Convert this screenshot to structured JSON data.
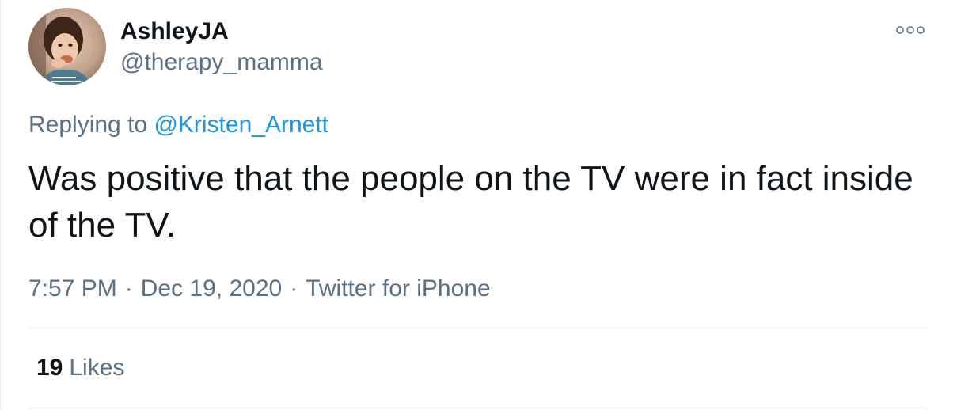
{
  "author": {
    "display_name": "AshleyJA",
    "handle": "@therapy_mamma"
  },
  "reply": {
    "prefix": "Replying to",
    "mention": "@Kristen_Arnett"
  },
  "tweet": {
    "text": "Was positive that the people on the TV were in fact inside of the TV."
  },
  "meta": {
    "time": "7:57 PM",
    "separator": "·",
    "date": "Dec 19, 2020",
    "source": "Twitter for iPhone"
  },
  "stats": {
    "likes_count": "19",
    "likes_label": "Likes"
  },
  "icons": {
    "more": "more-options-icon"
  },
  "colors": {
    "text_primary": "#0f1419",
    "text_secondary": "#5b7083",
    "link": "#1b95e0",
    "divider": "#e6ecf0"
  }
}
